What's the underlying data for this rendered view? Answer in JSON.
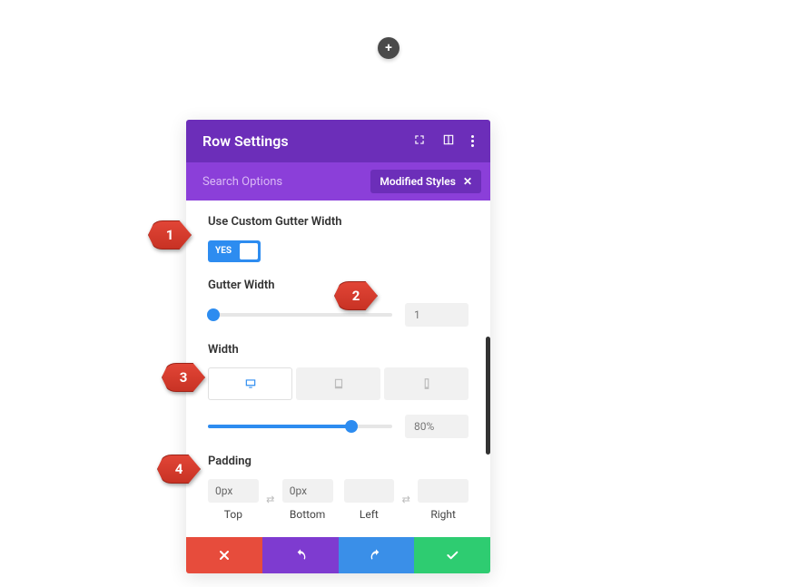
{
  "add_button_glyph": "+",
  "header": {
    "title": "Row Settings"
  },
  "search": {
    "placeholder": "Search Options",
    "filter_chip": "Modified Styles",
    "filter_close": "✕"
  },
  "fields": {
    "use_custom_gutter": {
      "label": "Use Custom Gutter Width",
      "toggle_text": "YES"
    },
    "gutter_width": {
      "label": "Gutter Width",
      "value": "1"
    },
    "width": {
      "label": "Width",
      "value": "80%"
    },
    "padding": {
      "label": "Padding",
      "top": {
        "value": "0px",
        "label": "Top"
      },
      "bottom": {
        "value": "0px",
        "label": "Bottom"
      },
      "left": {
        "value": "",
        "label": "Left"
      },
      "right": {
        "value": "",
        "label": "Right"
      },
      "link_glyph": "⇄"
    }
  },
  "annotations": {
    "a1": "1",
    "a2": "2",
    "a3": "3",
    "a4": "4"
  },
  "colors": {
    "header_bg": "#6c2eb9",
    "subheader_bg": "#8b3fd9",
    "accent": "#2d8cf0",
    "cancel": "#e74c3c",
    "undo": "#7e3bd0",
    "redo": "#3a8fe8",
    "save": "#2ecc71",
    "annot": "#d6392b"
  }
}
